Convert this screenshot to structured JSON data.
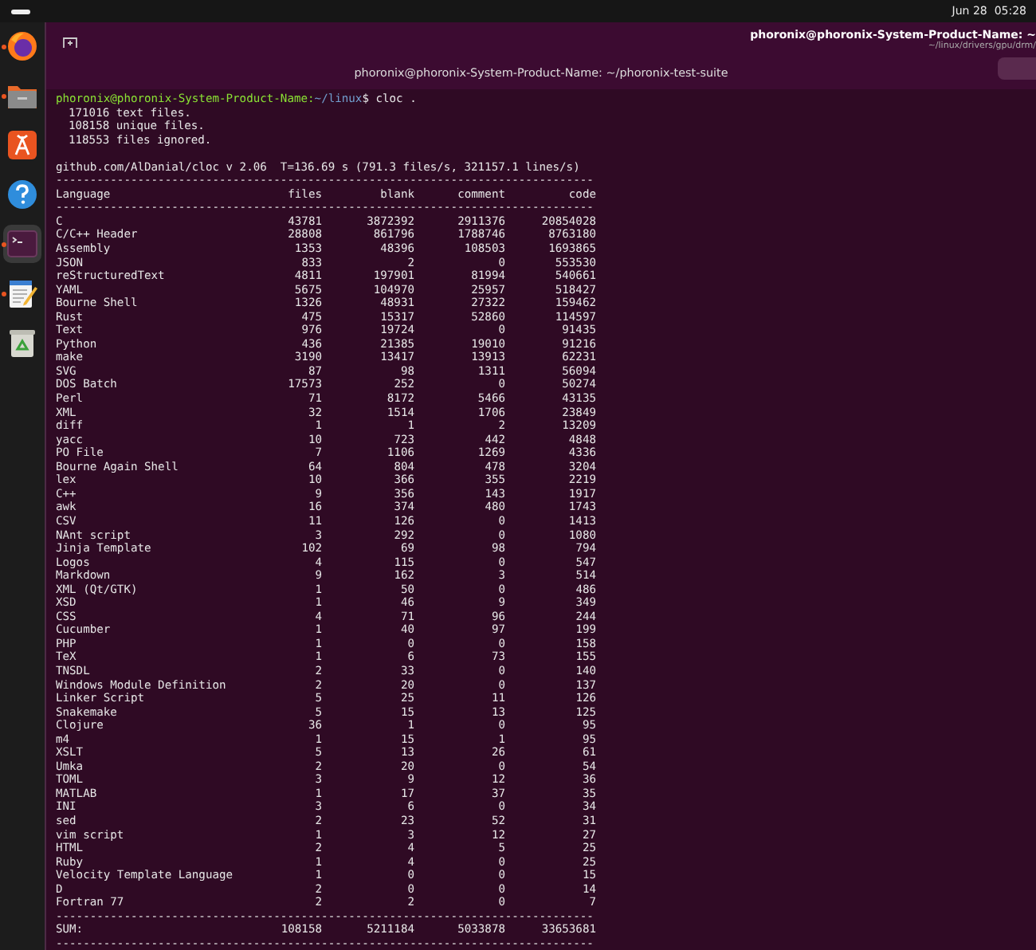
{
  "top_bar": {
    "clock": "Jun 28  05:28"
  },
  "dock": {
    "items": [
      {
        "kind": "browser",
        "running": true,
        "selected": false
      },
      {
        "kind": "files",
        "running": true,
        "selected": false
      },
      {
        "kind": "store",
        "running": false,
        "selected": false
      },
      {
        "kind": "help",
        "running": false,
        "selected": false
      },
      {
        "kind": "terminal",
        "running": true,
        "selected": true
      },
      {
        "kind": "editor",
        "running": true,
        "selected": false
      },
      {
        "kind": "trash",
        "running": false,
        "selected": false
      }
    ]
  },
  "overlay_window": {
    "title": "phoronix@phoronix-System-Product-Name: ~",
    "subtitle": "~/linux/drivers/gpu/drm/"
  },
  "terminal": {
    "title": "phoronix@phoronix-System-Product-Name: ~/phoronix-test-suite",
    "prompt": {
      "user_host": "phoronix@phoronix-System-Product-Name:",
      "path": "~/linux",
      "command": "$ cloc ."
    },
    "summary_lines": [
      "171016 text files.",
      "108158 unique files.",
      "118553 files ignored."
    ],
    "header_line": "github.com/AlDanial/cloc v 2.06  T=136.69 s (791.3 files/s, 321157.1 lines/s)",
    "separator": "-------------------------------------------------------------------------------",
    "columns": [
      "Language",
      "files",
      "blank",
      "comment",
      "code"
    ],
    "rows": [
      [
        "C",
        "43781",
        "3872392",
        "2911376",
        "20854028"
      ],
      [
        "C/C++ Header",
        "28808",
        "861796",
        "1788746",
        "8763180"
      ],
      [
        "Assembly",
        "1353",
        "48396",
        "108503",
        "1693865"
      ],
      [
        "JSON",
        "833",
        "2",
        "0",
        "553530"
      ],
      [
        "reStructuredText",
        "4811",
        "197901",
        "81994",
        "540661"
      ],
      [
        "YAML",
        "5675",
        "104970",
        "25957",
        "518427"
      ],
      [
        "Bourne Shell",
        "1326",
        "48931",
        "27322",
        "159462"
      ],
      [
        "Rust",
        "475",
        "15317",
        "52860",
        "114597"
      ],
      [
        "Text",
        "976",
        "19724",
        "0",
        "91435"
      ],
      [
        "Python",
        "436",
        "21385",
        "19010",
        "91216"
      ],
      [
        "make",
        "3190",
        "13417",
        "13913",
        "62231"
      ],
      [
        "SVG",
        "87",
        "98",
        "1311",
        "56094"
      ],
      [
        "DOS Batch",
        "17573",
        "252",
        "0",
        "50274"
      ],
      [
        "Perl",
        "71",
        "8172",
        "5466",
        "43135"
      ],
      [
        "XML",
        "32",
        "1514",
        "1706",
        "23849"
      ],
      [
        "diff",
        "1",
        "1",
        "2",
        "13209"
      ],
      [
        "yacc",
        "10",
        "723",
        "442",
        "4848"
      ],
      [
        "PO File",
        "7",
        "1106",
        "1269",
        "4336"
      ],
      [
        "Bourne Again Shell",
        "64",
        "804",
        "478",
        "3204"
      ],
      [
        "lex",
        "10",
        "366",
        "355",
        "2219"
      ],
      [
        "C++",
        "9",
        "356",
        "143",
        "1917"
      ],
      [
        "awk",
        "16",
        "374",
        "480",
        "1743"
      ],
      [
        "CSV",
        "11",
        "126",
        "0",
        "1413"
      ],
      [
        "NAnt script",
        "3",
        "292",
        "0",
        "1080"
      ],
      [
        "Jinja Template",
        "102",
        "69",
        "98",
        "794"
      ],
      [
        "Logos",
        "4",
        "115",
        "0",
        "547"
      ],
      [
        "Markdown",
        "9",
        "162",
        "3",
        "514"
      ],
      [
        "XML (Qt/GTK)",
        "1",
        "50",
        "0",
        "486"
      ],
      [
        "XSD",
        "1",
        "46",
        "9",
        "349"
      ],
      [
        "CSS",
        "4",
        "71",
        "96",
        "244"
      ],
      [
        "Cucumber",
        "1",
        "40",
        "97",
        "199"
      ],
      [
        "PHP",
        "1",
        "0",
        "0",
        "158"
      ],
      [
        "TeX",
        "1",
        "6",
        "73",
        "155"
      ],
      [
        "TNSDL",
        "2",
        "33",
        "0",
        "140"
      ],
      [
        "Windows Module Definition",
        "2",
        "20",
        "0",
        "137"
      ],
      [
        "Linker Script",
        "5",
        "25",
        "11",
        "126"
      ],
      [
        "Snakemake",
        "5",
        "15",
        "13",
        "125"
      ],
      [
        "Clojure",
        "36",
        "1",
        "0",
        "95"
      ],
      [
        "m4",
        "1",
        "15",
        "1",
        "95"
      ],
      [
        "XSLT",
        "5",
        "13",
        "26",
        "61"
      ],
      [
        "Umka",
        "2",
        "20",
        "0",
        "54"
      ],
      [
        "TOML",
        "3",
        "9",
        "12",
        "36"
      ],
      [
        "MATLAB",
        "1",
        "17",
        "37",
        "35"
      ],
      [
        "INI",
        "3",
        "6",
        "0",
        "34"
      ],
      [
        "sed",
        "2",
        "23",
        "52",
        "31"
      ],
      [
        "vim script",
        "1",
        "3",
        "12",
        "27"
      ],
      [
        "HTML",
        "2",
        "4",
        "5",
        "25"
      ],
      [
        "Ruby",
        "1",
        "4",
        "0",
        "25"
      ],
      [
        "Velocity Template Language",
        "1",
        "0",
        "0",
        "15"
      ],
      [
        "D",
        "2",
        "0",
        "0",
        "14"
      ],
      [
        "Fortran 77",
        "2",
        "2",
        "0",
        "7"
      ]
    ],
    "sum": [
      "SUM:",
      "108158",
      "5211184",
      "5033878",
      "33653681"
    ]
  }
}
